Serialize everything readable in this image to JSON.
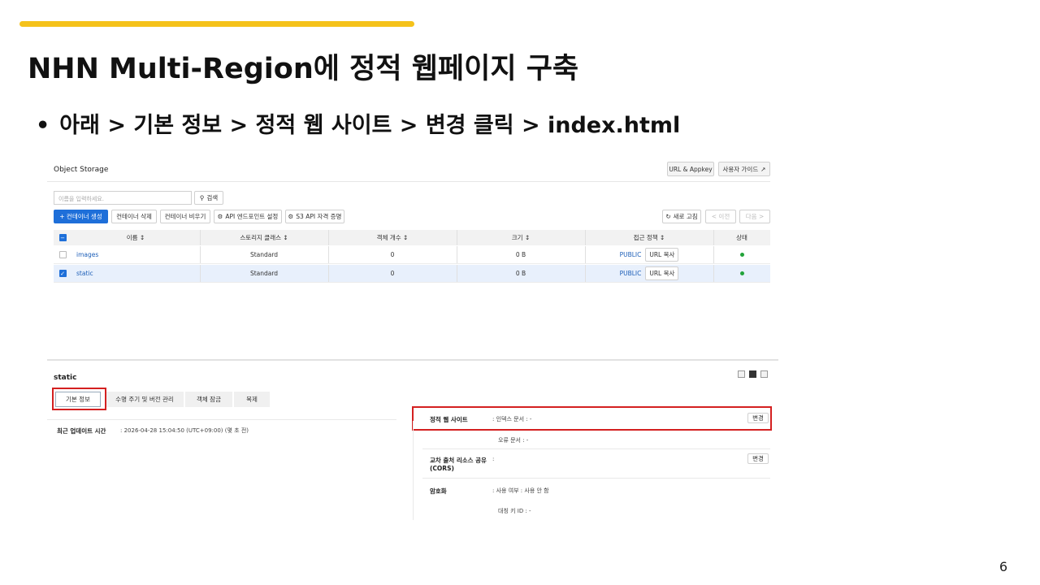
{
  "slide": {
    "title": "NHN Multi-Region에 정적 웹페이지 구축",
    "bullet_dot": "•",
    "bullet": "아래 > 기본 정보 > 정적 웹 사이트 > 변경 클릭 > index.html",
    "page_number": "6",
    "accent_color": "#f5c21a"
  },
  "screenshot": {
    "header": {
      "title": "Object Storage",
      "url_appkey": "URL & Appkey",
      "user_guide": "사용자 가이드"
    },
    "search": {
      "placeholder": "이름을 입력하세요.",
      "button": "검색"
    },
    "toolbar": {
      "create": "+ 컨테이너 생성",
      "delete": "컨테이너 삭제",
      "empty": "컨테이너 비우기",
      "api_endpoint": "API 엔드포인트 설정",
      "s3_credential": "S3 API 자격 증명",
      "refresh": "새로 고침",
      "prev": "< 이전",
      "next": "다음 >"
    },
    "table": {
      "columns": [
        "이름 ↕",
        "스토리지 클래스 ↕",
        "객체 개수 ↕",
        "크기 ↕",
        "접근 정책 ↕",
        "상태"
      ],
      "rows": [
        {
          "name": "images",
          "storage_class": "Standard",
          "objects": "0",
          "size": "0 B",
          "policy": "PUBLIC",
          "copy": "URL 복사",
          "selected": false
        },
        {
          "name": "static",
          "storage_class": "Standard",
          "objects": "0",
          "size": "0 B",
          "policy": "PUBLIC",
          "copy": "URL 복사",
          "selected": true
        }
      ],
      "status_color": "#22a33a"
    },
    "detail": {
      "title": "static",
      "tabs": [
        "기본 정보",
        "수명 주기 및 버전 관리",
        "객체 잠금",
        "복제"
      ],
      "updated_label": "최근 업데이트 시간",
      "updated_value": ":   2026-04-28 15:04:50 (UTC+09:00) (몇 초 전)",
      "static_site_label": "정적 웹 사이트",
      "index_doc": ":   인덱스 문서 : -",
      "error_doc": "오류 문서 : -",
      "change": "변경",
      "cors_label_1": "교차 출처 리소스 공유",
      "cors_label_2": "(CORS)",
      "colon": ":",
      "encryption_label": "암호화",
      "encryption_use": ":   사용 여부 : 사용 안 함",
      "symmetric_key": "대칭 키 ID : -"
    }
  }
}
